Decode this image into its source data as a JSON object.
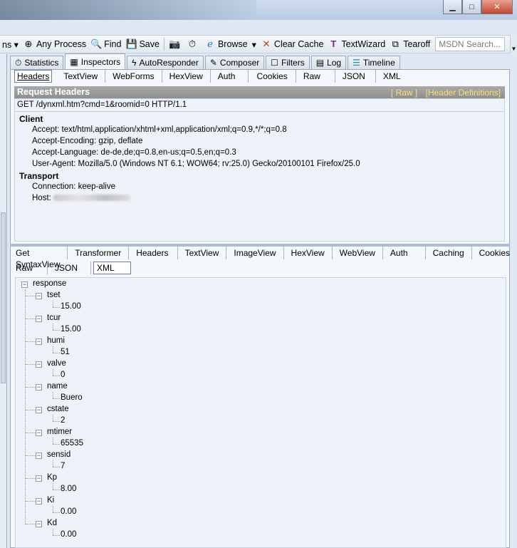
{
  "window": {
    "min": "▁",
    "max": "□",
    "close": "✕"
  },
  "toolbar": {
    "cut_label": "ns ▾",
    "any_process": "Any Process",
    "find": "Find",
    "save": "Save",
    "browse": "Browse",
    "browse_arrow": "▾",
    "clear_cache": "Clear Cache",
    "textwizard": "TextWizard",
    "tearoff": "Tearoff",
    "msdn_placeholder": "MSDN Search...",
    "scroll_icon": "▼"
  },
  "main_tabs": [
    {
      "label": "Statistics",
      "icon": "stopwatch-icon"
    },
    {
      "label": "Inspectors",
      "icon": "inspector-icon"
    },
    {
      "label": "AutoResponder",
      "icon": "lightning-icon"
    },
    {
      "label": "Composer",
      "icon": "pencil-icon"
    },
    {
      "label": "Filters",
      "icon": "checkbox-icon"
    },
    {
      "label": "Log",
      "icon": "log-icon"
    },
    {
      "label": "Timeline",
      "icon": "timeline-icon"
    }
  ],
  "request_tabs": [
    "Headers",
    "TextView",
    "WebForms",
    "HexView",
    "Auth",
    "Cookies",
    "Raw",
    "JSON",
    "XML"
  ],
  "request_headers": {
    "title": "Request Headers",
    "raw_link": "[ Raw ]",
    "defs_link": "[Header Definitions]",
    "request_line": "GET /dynxml.htm?cmd=1&roomid=0 HTTP/1.1",
    "groups": [
      {
        "name": "Client",
        "lines": [
          "Accept: text/html,application/xhtml+xml,application/xml;q=0.9,*/*;q=0.8",
          "Accept-Encoding: gzip, deflate",
          "Accept-Language: de-de,de;q=0.8,en-us;q=0.5,en;q=0.3",
          "User-Agent: Mozilla/5.0 (Windows NT 6.1; WOW64; rv:25.0) Gecko/20100101 Firefox/25.0"
        ]
      },
      {
        "name": "Transport",
        "lines": [
          "Connection: keep-alive",
          "Host:"
        ]
      }
    ]
  },
  "response_tabs_row1": [
    "Get SyntaxView",
    "Transformer",
    "Headers",
    "TextView",
    "ImageView",
    "HexView",
    "WebView",
    "Auth",
    "Caching",
    "Cookies"
  ],
  "response_tabs_row2": [
    "Raw",
    "JSON",
    "XML"
  ],
  "tree": {
    "root": "response",
    "collapse_glyph": "−",
    "nodes": [
      {
        "name": "tset",
        "value": "15.00"
      },
      {
        "name": "tcur",
        "value": "15.00"
      },
      {
        "name": "humi",
        "value": "51"
      },
      {
        "name": "valve",
        "value": "0"
      },
      {
        "name": "name",
        "value": "Buero"
      },
      {
        "name": "cstate",
        "value": "2"
      },
      {
        "name": "mtimer",
        "value": "65535"
      },
      {
        "name": "sensid",
        "value": "7"
      },
      {
        "name": "Kp",
        "value": "8.00"
      },
      {
        "name": "Ki",
        "value": "0.00"
      },
      {
        "name": "Kd",
        "value": "0.00"
      }
    ]
  }
}
